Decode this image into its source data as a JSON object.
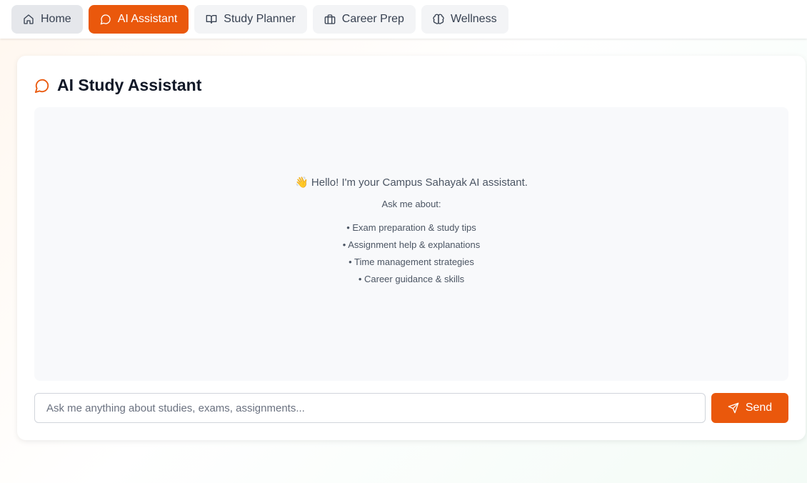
{
  "nav": {
    "items": [
      {
        "label": "Home",
        "icon": "home-icon"
      },
      {
        "label": "AI Assistant",
        "icon": "chat-bubble-icon",
        "active": true
      },
      {
        "label": "Study Planner",
        "icon": "book-icon"
      },
      {
        "label": "Career Prep",
        "icon": "briefcase-icon"
      },
      {
        "label": "Wellness",
        "icon": "brain-icon"
      }
    ]
  },
  "card": {
    "title": "AI Study Assistant",
    "icon": "chat-bubble-icon"
  },
  "chat": {
    "welcome": "👋 Hello! I'm your Campus Sahayak AI assistant.",
    "ask": "Ask me about:",
    "topics": [
      "• Exam preparation & study tips",
      "• Assignment help & explanations",
      "• Time management strategies",
      "• Career guidance & skills"
    ]
  },
  "input": {
    "value": "",
    "placeholder": "Ask me anything about studies, exams, assignments..."
  },
  "send": {
    "label": "Send",
    "icon": "send-icon"
  },
  "colors": {
    "accent": "#ea580c",
    "nav_bg": "#f3f4f6",
    "chat_bg": "#f8f9fb"
  }
}
